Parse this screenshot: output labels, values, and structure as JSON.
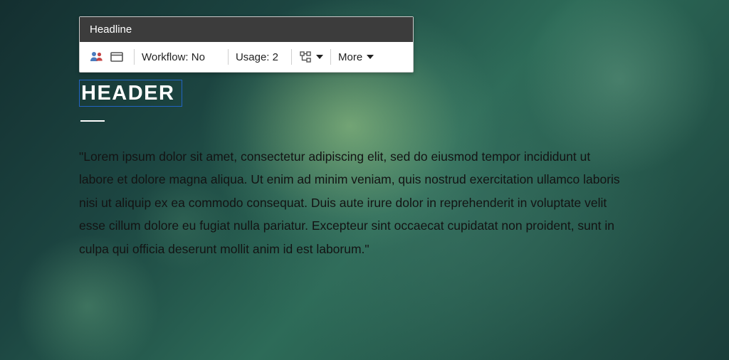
{
  "toolbar": {
    "title": "Headline",
    "workflow_label": "Workflow:",
    "workflow_value": "No",
    "usage_label": "Usage:",
    "usage_value": "2",
    "more_label": "More"
  },
  "content": {
    "header": "HEADER",
    "body": "\"Lorem ipsum dolor sit amet, consectetur adipiscing elit, sed do eiusmod tempor incididunt ut labore et dolore magna aliqua. Ut enim ad minim veniam, quis nostrud exercitation ullamco laboris nisi ut aliquip ex ea commodo consequat. Duis aute irure dolor in reprehenderit in voluptate velit esse cillum dolore eu fugiat nulla pariatur. Excepteur sint occaecat cupidatat non proident, sunt in culpa qui officia deserunt mollit anim id est laborum.\""
  }
}
